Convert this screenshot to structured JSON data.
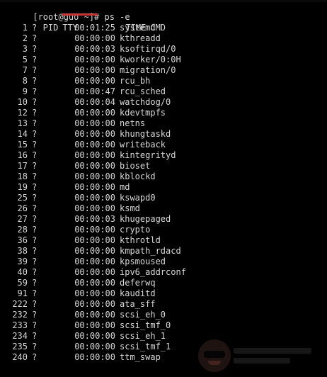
{
  "prompt": "[root@guo ~]# ps -e",
  "header": {
    "pid": "PID",
    "tty": "TTY",
    "time": "TIME",
    "cmd": "CMD"
  },
  "processes": [
    {
      "pid": "1",
      "tty": "?",
      "time": "00:01:25",
      "cmd": "systemd"
    },
    {
      "pid": "2",
      "tty": "?",
      "time": "00:00:00",
      "cmd": "kthreadd"
    },
    {
      "pid": "3",
      "tty": "?",
      "time": "00:00:03",
      "cmd": "ksoftirqd/0"
    },
    {
      "pid": "5",
      "tty": "?",
      "time": "00:00:00",
      "cmd": "kworker/0:0H"
    },
    {
      "pid": "7",
      "tty": "?",
      "time": "00:00:00",
      "cmd": "migration/0"
    },
    {
      "pid": "8",
      "tty": "?",
      "time": "00:00:00",
      "cmd": "rcu_bh"
    },
    {
      "pid": "9",
      "tty": "?",
      "time": "00:00:47",
      "cmd": "rcu_sched"
    },
    {
      "pid": "10",
      "tty": "?",
      "time": "00:00:04",
      "cmd": "watchdog/0"
    },
    {
      "pid": "12",
      "tty": "?",
      "time": "00:00:00",
      "cmd": "kdevtmpfs"
    },
    {
      "pid": "13",
      "tty": "?",
      "time": "00:00:00",
      "cmd": "netns"
    },
    {
      "pid": "14",
      "tty": "?",
      "time": "00:00:00",
      "cmd": "khungtaskd"
    },
    {
      "pid": "15",
      "tty": "?",
      "time": "00:00:00",
      "cmd": "writeback"
    },
    {
      "pid": "16",
      "tty": "?",
      "time": "00:00:00",
      "cmd": "kintegrityd"
    },
    {
      "pid": "17",
      "tty": "?",
      "time": "00:00:00",
      "cmd": "bioset"
    },
    {
      "pid": "18",
      "tty": "?",
      "time": "00:00:00",
      "cmd": "kblockd"
    },
    {
      "pid": "19",
      "tty": "?",
      "time": "00:00:00",
      "cmd": "md"
    },
    {
      "pid": "25",
      "tty": "?",
      "time": "00:00:00",
      "cmd": "kswapd0"
    },
    {
      "pid": "26",
      "tty": "?",
      "time": "00:00:00",
      "cmd": "ksmd"
    },
    {
      "pid": "27",
      "tty": "?",
      "time": "00:00:03",
      "cmd": "khugepaged"
    },
    {
      "pid": "28",
      "tty": "?",
      "time": "00:00:00",
      "cmd": "crypto"
    },
    {
      "pid": "36",
      "tty": "?",
      "time": "00:00:00",
      "cmd": "kthrotld"
    },
    {
      "pid": "38",
      "tty": "?",
      "time": "00:00:00",
      "cmd": "kmpath_rdacd"
    },
    {
      "pid": "39",
      "tty": "?",
      "time": "00:00:00",
      "cmd": "kpsmoused"
    },
    {
      "pid": "40",
      "tty": "?",
      "time": "00:00:00",
      "cmd": "ipv6_addrconf"
    },
    {
      "pid": "59",
      "tty": "?",
      "time": "00:00:00",
      "cmd": "deferwq"
    },
    {
      "pid": "91",
      "tty": "?",
      "time": "00:00:00",
      "cmd": "kauditd"
    },
    {
      "pid": "222",
      "tty": "?",
      "time": "00:00:00",
      "cmd": "ata_sff"
    },
    {
      "pid": "232",
      "tty": "?",
      "time": "00:00:00",
      "cmd": "scsi_eh_0"
    },
    {
      "pid": "233",
      "tty": "?",
      "time": "00:00:00",
      "cmd": "scsi_tmf_0"
    },
    {
      "pid": "234",
      "tty": "?",
      "time": "00:00:00",
      "cmd": "scsi_eh_1"
    },
    {
      "pid": "235",
      "tty": "?",
      "time": "00:00:00",
      "cmd": "scsi_tmf_1"
    },
    {
      "pid": "240",
      "tty": "?",
      "time": "00:00:00",
      "cmd": "ttm_swap"
    }
  ],
  "colors": {
    "background": "#000000",
    "text": "#d8d8d8",
    "redaction": "#c83232"
  }
}
